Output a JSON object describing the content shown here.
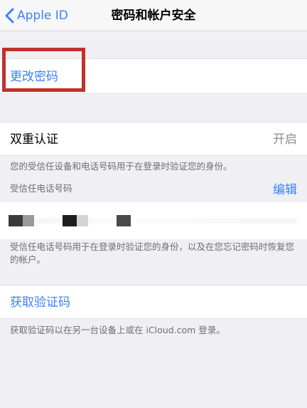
{
  "nav": {
    "back_label": "Apple ID",
    "title": "密码和帐户安全"
  },
  "change_password": {
    "label": "更改密码"
  },
  "two_factor": {
    "label": "双重认证",
    "status": "开启",
    "description": "您的受信任设备和电话号码用于在登录时验证您的身份。"
  },
  "trusted_phones": {
    "header": "受信任电话号码",
    "edit_label": "编辑",
    "description": "受信任电话号码用于在登录时验证您的身份，以及在您忘记密码时恢复您的帐户。"
  },
  "verification": {
    "label": "获取验证码",
    "description": "获取验证码以在另一台设备上或在 iCloud.com 登录。"
  },
  "colors": {
    "accent": "#3b82f6",
    "highlight_border": "#c0312b",
    "background": "#efeff4"
  }
}
